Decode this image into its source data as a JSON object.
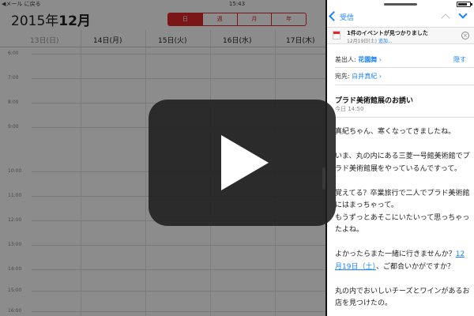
{
  "status_bar": {
    "back_label": "◀メール に戻る",
    "time": "15:43",
    "battery_level": 0.8
  },
  "calendar": {
    "year": "2015年",
    "month": "12月",
    "views": [
      "日",
      "週",
      "月",
      "年"
    ],
    "active_view": "日",
    "days": [
      "13日(日)",
      "14日(月)",
      "15日(火)",
      "16日(水)",
      "17日(木)"
    ],
    "hours": [
      "6:00",
      "7:00",
      "8:00",
      "9:00",
      "10:00",
      "11:00",
      "12:00",
      "13:00",
      "14:00",
      "15:00",
      "16:00"
    ]
  },
  "mail": {
    "nav": {
      "back_label": "受信"
    },
    "event_banner": {
      "title": "1件のイベントが見つかりました",
      "date": "12月19日(土)",
      "add_label": "追加..."
    },
    "from_label": "差出人:",
    "from_name": "花園舞",
    "hide_label": "隠す",
    "to_label": "宛先:",
    "to_name": "白井真紀",
    "subject": "プラド美術館展のお誘い",
    "date": "今日 14:50",
    "body": {
      "p1": "真紀ちゃん、寒くなってきましたね。",
      "p2": "いま、丸の内にある三菱一号館美術館でプラド美術館展をやっているんですって。",
      "p3": "覚えてる？卒業旅行で二人でプラド美術館にはまっちゃって。",
      "p4": "もうずっとあそこにいたいって思っちゃったよね。",
      "p5_before": "よかったらまた一緒に行きませんか？",
      "p5_link": "12月19日（土）",
      "p5_after": "、ご都合いかがですか？",
      "p6": "丸の内でおいしいチーズとワインがあるお店を見つけたの。"
    }
  },
  "colors": {
    "accent": "#1a82fb",
    "calendar_red": "#e0282c"
  }
}
